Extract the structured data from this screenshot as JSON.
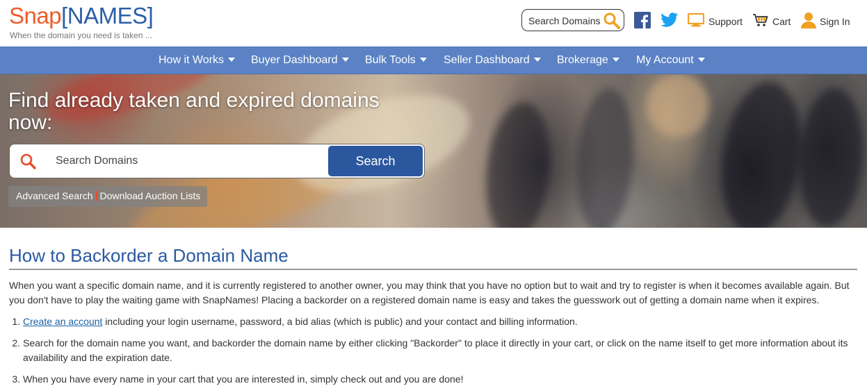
{
  "header": {
    "logo_snap": "Snap",
    "logo_bracket_open": "[",
    "logo_names": "NAMES",
    "logo_bracket_close": "]",
    "tagline": "When the domain you need is taken ...",
    "search_label": "Search Domains",
    "support_label": "Support",
    "cart_label": "Cart",
    "signin_label": "Sign In"
  },
  "nav": {
    "items": [
      {
        "label": "How it Works"
      },
      {
        "label": "Buyer Dashboard"
      },
      {
        "label": "Bulk Tools"
      },
      {
        "label": "Seller Dashboard"
      },
      {
        "label": "Brokerage"
      },
      {
        "label": "My Account"
      }
    ]
  },
  "hero": {
    "title": "Find already taken and expired domains now:",
    "search_placeholder": "Search Domains",
    "search_button": "Search",
    "link_advanced": "Advanced Search",
    "link_download": "Download Auction Lists"
  },
  "content": {
    "heading": "How to Backorder a Domain Name",
    "intro": "When you want a specific domain name, and it is currently registered to another owner, you may think that you have no option but to wait and try to register is when it becomes available again. But you don't have to play the waiting game with SnapNames! Placing a backorder on a registered domain name is easy and takes the guesswork out of getting a domain name when it expires.",
    "steps": [
      {
        "link": "Create an account",
        "text": " including your login username, password, a bid alias (which is public) and your contact and billing information."
      },
      {
        "text": "Search for the domain name you want, and backorder the domain name by either clicking \"Backorder\" to place it directly in your cart, or click on the name itself to get more information about its availability and the expiration date."
      },
      {
        "text": "When you have every name in your cart that you are interested in, simply check out and you are done!"
      }
    ]
  },
  "colors": {
    "brand_orange": "#ef5b2a",
    "brand_blue": "#2c5ea8",
    "nav_bg": "#5b82c4",
    "button_blue": "#2b579e"
  }
}
